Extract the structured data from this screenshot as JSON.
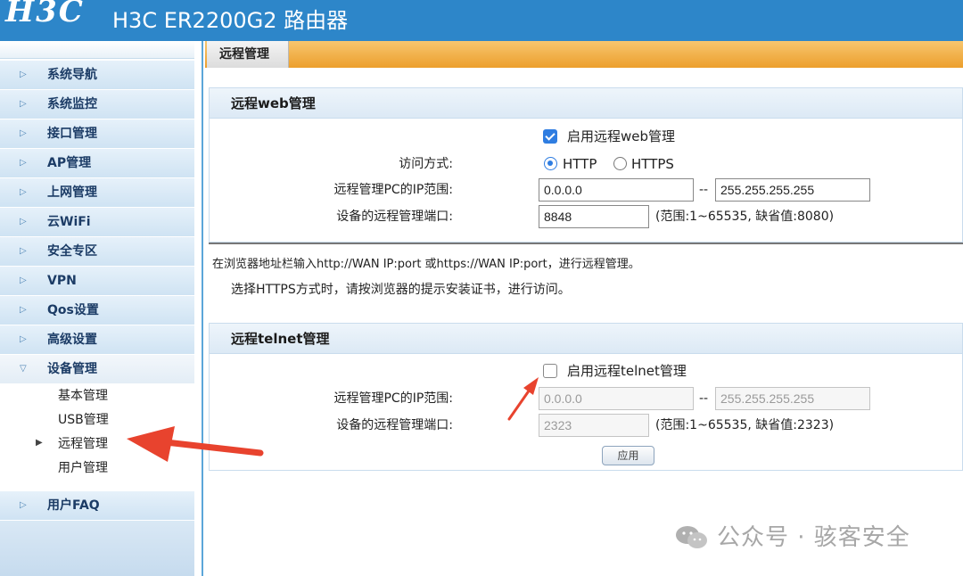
{
  "header": {
    "logo": "H3C",
    "title": "H3C ER2200G2 路由器"
  },
  "sidebar": {
    "items": [
      {
        "label": "系统导航"
      },
      {
        "label": "系统监控"
      },
      {
        "label": "接口管理"
      },
      {
        "label": "AP管理"
      },
      {
        "label": "上网管理"
      },
      {
        "label": "云WiFi"
      },
      {
        "label": "安全专区"
      },
      {
        "label": "VPN"
      },
      {
        "label": "Qos设置"
      },
      {
        "label": "高级设置"
      },
      {
        "label": "设备管理"
      }
    ],
    "sub_items": [
      {
        "label": "基本管理"
      },
      {
        "label": "USB管理"
      },
      {
        "label": "远程管理"
      },
      {
        "label": "用户管理"
      }
    ],
    "faq": "用户FAQ"
  },
  "tab": {
    "label": "远程管理"
  },
  "web": {
    "title": "远程web管理",
    "enable_label": "启用远程web管理",
    "enable_checked": true,
    "access_label": "访问方式:",
    "http_label": "HTTP",
    "https_label": "HTTPS",
    "access_selected": "HTTP",
    "ip_range_label": "远程管理PC的IP范围:",
    "ip_start": "0.0.0.0",
    "dash": "--",
    "ip_end": "255.255.255.255",
    "port_label": "设备的远程管理端口:",
    "port": "8848",
    "port_hint": "(范围:1~65535, 缺省值:8080)"
  },
  "notes": {
    "line1": "在浏览器地址栏输入http://WAN IP:port 或https://WAN IP:port，进行远程管理。",
    "line2": "选择HTTPS方式时，请按浏览器的提示安装证书，进行访问。"
  },
  "telnet": {
    "title": "远程telnet管理",
    "enable_label": "启用远程telnet管理",
    "enable_checked": false,
    "ip_range_label": "远程管理PC的IP范围:",
    "ip_start": "0.0.0.0",
    "dash": "--",
    "ip_end": "255.255.255.255",
    "port_label": "设备的远程管理端口:",
    "port": "2323",
    "port_hint": "(范围:1~65535, 缺省值:2323)"
  },
  "apply_label": "应用",
  "watermark": "公众号 · 骇客安全",
  "colors": {
    "header": "#2d86c9",
    "tabbar": "#ec9f2c",
    "arrow": "#e8432e",
    "accent": "#2f7de1"
  }
}
